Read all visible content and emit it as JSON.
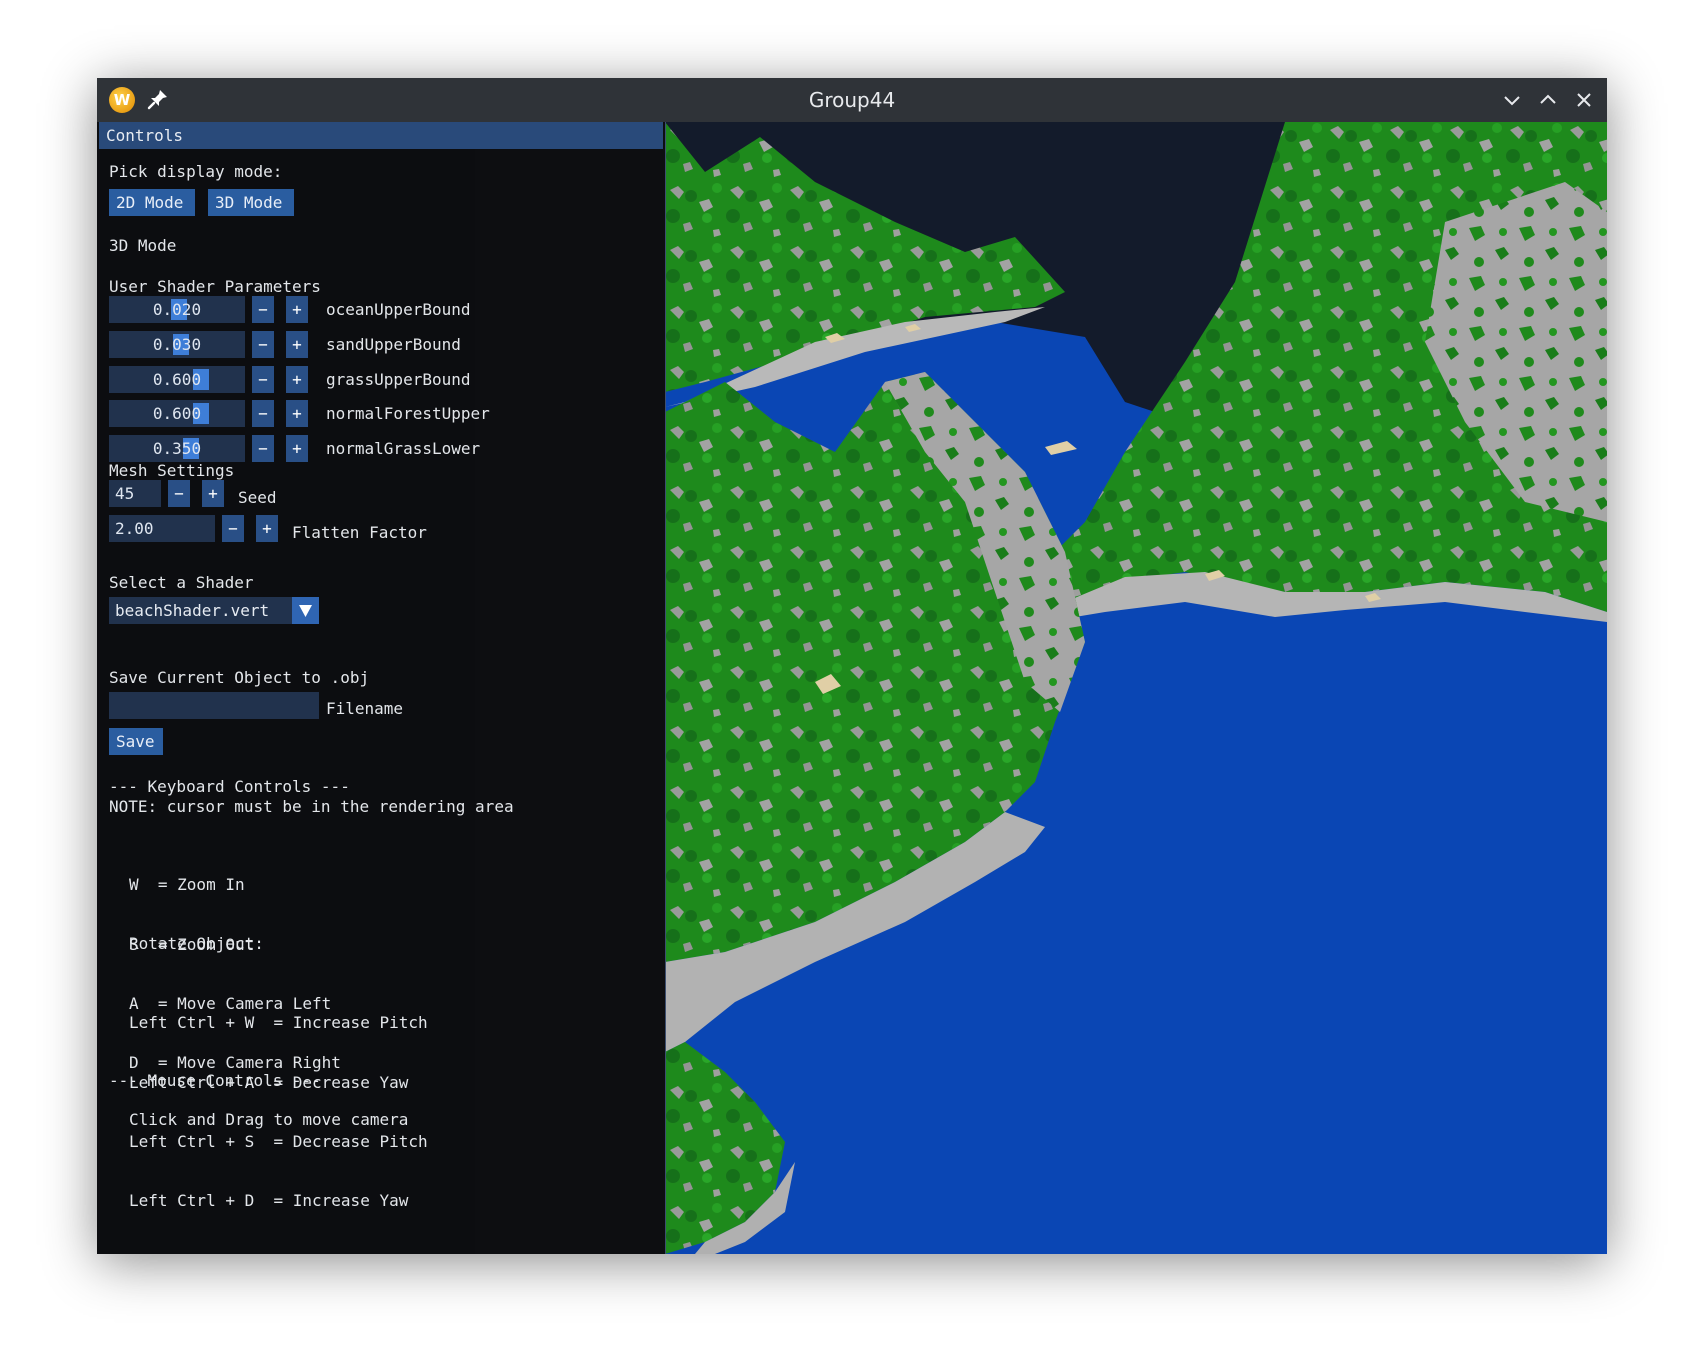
{
  "window": {
    "title": "Group44",
    "app_icon_letter": "W"
  },
  "panel": {
    "title": "Controls",
    "display_mode_prompt": "Pick display mode:",
    "mode_buttons": [
      "2D Mode",
      "3D Mode"
    ],
    "current_mode": "3D Mode",
    "shader_params_heading": "User Shader Parameters",
    "shader_params": [
      {
        "value": "0.020",
        "label": "oceanUpperBound",
        "fraction": 0.02
      },
      {
        "value": "0.030",
        "label": "sandUpperBound",
        "fraction": 0.03
      },
      {
        "value": "0.600",
        "label": "grassUpperBound",
        "fraction": 0.6
      },
      {
        "value": "0.600",
        "label": "normalForestUpper",
        "fraction": 0.6
      },
      {
        "value": "0.350",
        "label": "normalGrassLower",
        "fraction": 0.35
      }
    ],
    "minus": "−",
    "plus": "+",
    "mesh_heading": "Mesh Settings",
    "seed": {
      "value": "45",
      "label": "Seed"
    },
    "flatten": {
      "value": "2.00",
      "label": "Flatten Factor"
    },
    "shader_select_heading": "Select a Shader",
    "shader_selected": "beachShader.vert",
    "save_heading": "Save Current Object to .obj",
    "filename": {
      "value": "",
      "label": "Filename"
    },
    "save_button": "Save",
    "keyboard_heading": "--- Keyboard Controls ---",
    "keyboard_note": "NOTE: cursor must be in the rendering area",
    "key_lines": [
      "W  = Zoom In",
      "S  = Zoom Out",
      "A  = Move Camera Left",
      "D  = Move Camera Right"
    ],
    "rotate_heading": "Rotate Object:",
    "rotate_lines": [
      "Left Ctrl + W  = Increase Pitch",
      "Left Ctrl + A  = Decrease Yaw",
      "Left Ctrl + S  = Decrease Pitch",
      "Left Ctrl + D  = Increase Yaw"
    ],
    "mouse_heading": "--- Mouse Controls ---",
    "mouse_line": "Click and Drag to move camera"
  },
  "colors": {
    "accent": "#2a5da0",
    "panel_title": "#294a7a",
    "ocean": "#0a46b4",
    "grass": "#1f8a1c",
    "rock": "#9a9a9a",
    "sand": "#d9c7a0",
    "sky": "#131b2b"
  }
}
